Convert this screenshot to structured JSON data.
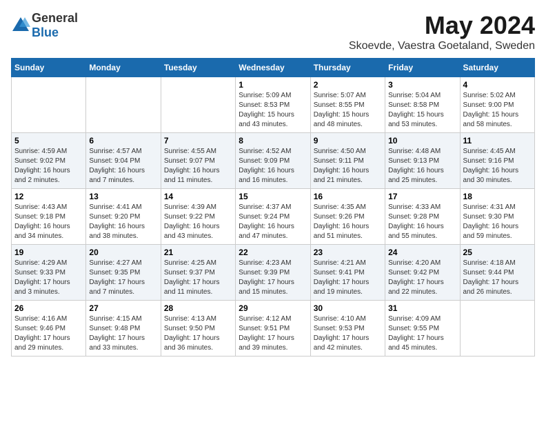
{
  "header": {
    "logo_general": "General",
    "logo_blue": "Blue",
    "month_year": "May 2024",
    "location": "Skoevde, Vaestra Goetaland, Sweden"
  },
  "weekdays": [
    "Sunday",
    "Monday",
    "Tuesday",
    "Wednesday",
    "Thursday",
    "Friday",
    "Saturday"
  ],
  "weeks": [
    [
      {
        "day": "",
        "info": ""
      },
      {
        "day": "",
        "info": ""
      },
      {
        "day": "",
        "info": ""
      },
      {
        "day": "1",
        "info": "Sunrise: 5:09 AM\nSunset: 8:53 PM\nDaylight: 15 hours and 43 minutes."
      },
      {
        "day": "2",
        "info": "Sunrise: 5:07 AM\nSunset: 8:55 PM\nDaylight: 15 hours and 48 minutes."
      },
      {
        "day": "3",
        "info": "Sunrise: 5:04 AM\nSunset: 8:58 PM\nDaylight: 15 hours and 53 minutes."
      },
      {
        "day": "4",
        "info": "Sunrise: 5:02 AM\nSunset: 9:00 PM\nDaylight: 15 hours and 58 minutes."
      }
    ],
    [
      {
        "day": "5",
        "info": "Sunrise: 4:59 AM\nSunset: 9:02 PM\nDaylight: 16 hours and 2 minutes."
      },
      {
        "day": "6",
        "info": "Sunrise: 4:57 AM\nSunset: 9:04 PM\nDaylight: 16 hours and 7 minutes."
      },
      {
        "day": "7",
        "info": "Sunrise: 4:55 AM\nSunset: 9:07 PM\nDaylight: 16 hours and 11 minutes."
      },
      {
        "day": "8",
        "info": "Sunrise: 4:52 AM\nSunset: 9:09 PM\nDaylight: 16 hours and 16 minutes."
      },
      {
        "day": "9",
        "info": "Sunrise: 4:50 AM\nSunset: 9:11 PM\nDaylight: 16 hours and 21 minutes."
      },
      {
        "day": "10",
        "info": "Sunrise: 4:48 AM\nSunset: 9:13 PM\nDaylight: 16 hours and 25 minutes."
      },
      {
        "day": "11",
        "info": "Sunrise: 4:45 AM\nSunset: 9:16 PM\nDaylight: 16 hours and 30 minutes."
      }
    ],
    [
      {
        "day": "12",
        "info": "Sunrise: 4:43 AM\nSunset: 9:18 PM\nDaylight: 16 hours and 34 minutes."
      },
      {
        "day": "13",
        "info": "Sunrise: 4:41 AM\nSunset: 9:20 PM\nDaylight: 16 hours and 38 minutes."
      },
      {
        "day": "14",
        "info": "Sunrise: 4:39 AM\nSunset: 9:22 PM\nDaylight: 16 hours and 43 minutes."
      },
      {
        "day": "15",
        "info": "Sunrise: 4:37 AM\nSunset: 9:24 PM\nDaylight: 16 hours and 47 minutes."
      },
      {
        "day": "16",
        "info": "Sunrise: 4:35 AM\nSunset: 9:26 PM\nDaylight: 16 hours and 51 minutes."
      },
      {
        "day": "17",
        "info": "Sunrise: 4:33 AM\nSunset: 9:28 PM\nDaylight: 16 hours and 55 minutes."
      },
      {
        "day": "18",
        "info": "Sunrise: 4:31 AM\nSunset: 9:30 PM\nDaylight: 16 hours and 59 minutes."
      }
    ],
    [
      {
        "day": "19",
        "info": "Sunrise: 4:29 AM\nSunset: 9:33 PM\nDaylight: 17 hours and 3 minutes."
      },
      {
        "day": "20",
        "info": "Sunrise: 4:27 AM\nSunset: 9:35 PM\nDaylight: 17 hours and 7 minutes."
      },
      {
        "day": "21",
        "info": "Sunrise: 4:25 AM\nSunset: 9:37 PM\nDaylight: 17 hours and 11 minutes."
      },
      {
        "day": "22",
        "info": "Sunrise: 4:23 AM\nSunset: 9:39 PM\nDaylight: 17 hours and 15 minutes."
      },
      {
        "day": "23",
        "info": "Sunrise: 4:21 AM\nSunset: 9:41 PM\nDaylight: 17 hours and 19 minutes."
      },
      {
        "day": "24",
        "info": "Sunrise: 4:20 AM\nSunset: 9:42 PM\nDaylight: 17 hours and 22 minutes."
      },
      {
        "day": "25",
        "info": "Sunrise: 4:18 AM\nSunset: 9:44 PM\nDaylight: 17 hours and 26 minutes."
      }
    ],
    [
      {
        "day": "26",
        "info": "Sunrise: 4:16 AM\nSunset: 9:46 PM\nDaylight: 17 hours and 29 minutes."
      },
      {
        "day": "27",
        "info": "Sunrise: 4:15 AM\nSunset: 9:48 PM\nDaylight: 17 hours and 33 minutes."
      },
      {
        "day": "28",
        "info": "Sunrise: 4:13 AM\nSunset: 9:50 PM\nDaylight: 17 hours and 36 minutes."
      },
      {
        "day": "29",
        "info": "Sunrise: 4:12 AM\nSunset: 9:51 PM\nDaylight: 17 hours and 39 minutes."
      },
      {
        "day": "30",
        "info": "Sunrise: 4:10 AM\nSunset: 9:53 PM\nDaylight: 17 hours and 42 minutes."
      },
      {
        "day": "31",
        "info": "Sunrise: 4:09 AM\nSunset: 9:55 PM\nDaylight: 17 hours and 45 minutes."
      },
      {
        "day": "",
        "info": ""
      }
    ]
  ]
}
